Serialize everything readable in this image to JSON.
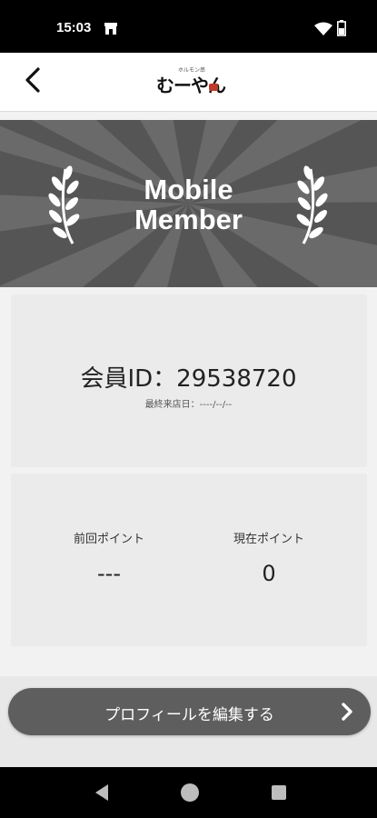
{
  "status_bar": {
    "time": "15:03",
    "icons": [
      "store-icon",
      "wifi-icon",
      "battery-icon"
    ]
  },
  "header": {
    "back_icon": "chevron-left-icon",
    "logo_small_text": "ホルモン串",
    "logo_main_text": "むーやん"
  },
  "banner": {
    "title_line1": "Mobile",
    "title_line2": "Member",
    "decor_icon": "laurel-icon"
  },
  "member": {
    "id_label": "会員ID：29538720",
    "last_visit": "最終来店日：----/--/--"
  },
  "points": {
    "previous_label": "前回ポイント",
    "previous_value": "---",
    "current_label": "現在ポイント",
    "current_value": "0"
  },
  "actions": {
    "edit_profile_label": "プロフィールを編集する",
    "edit_profile_icon": "chevron-right-icon"
  },
  "nav": {
    "back_icon": "triangle-back-icon",
    "home_icon": "circle-home-icon",
    "recents_icon": "square-recents-icon"
  },
  "colors": {
    "banner_bg": "#555555",
    "button_bg": "#5e5e5e",
    "card_bg": "#ebebeb"
  }
}
